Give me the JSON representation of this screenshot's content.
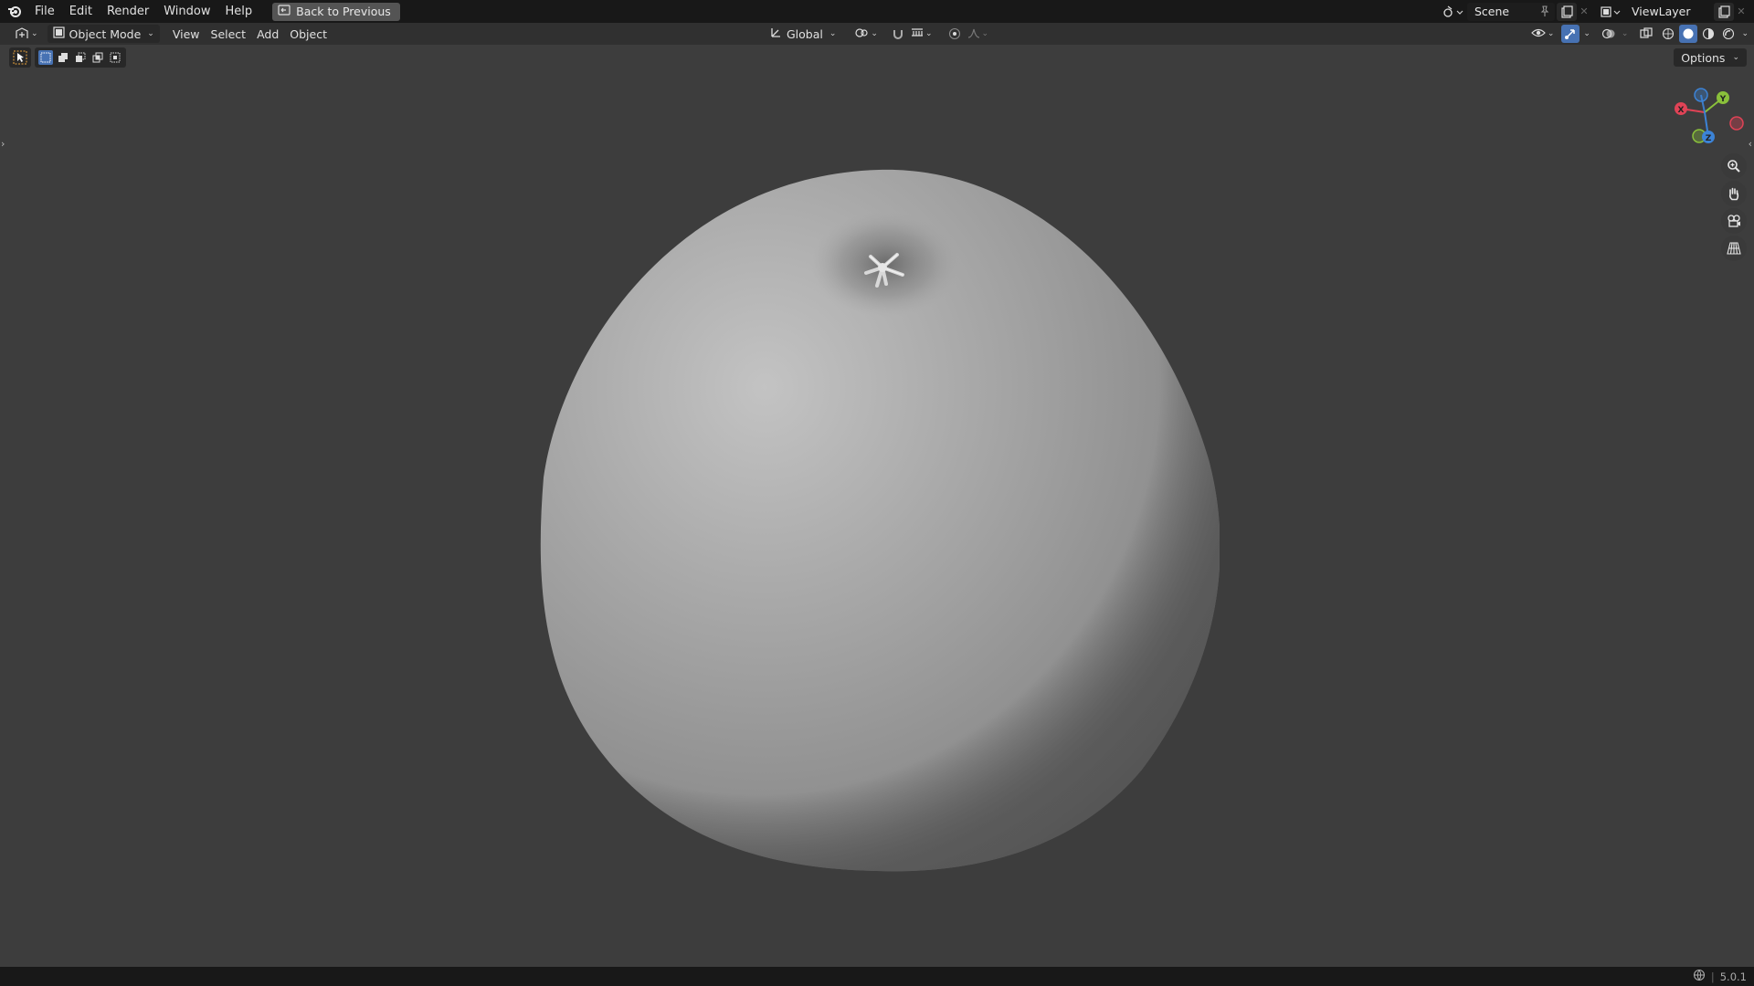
{
  "topbar": {
    "menu": [
      "File",
      "Edit",
      "Render",
      "Window",
      "Help"
    ],
    "back_button": "Back to Previous",
    "scene_name": "Scene",
    "view_layer_name": "ViewLayer"
  },
  "header": {
    "mode": "Object Mode",
    "menus": [
      "View",
      "Select",
      "Add",
      "Object"
    ],
    "transform_orientation": "Global"
  },
  "toolbar": {
    "options_label": "Options"
  },
  "gizmo": {
    "x_label": "X",
    "y_label": "Y",
    "z_label": "Z",
    "colors": {
      "x": "#e04356",
      "y": "#8ac03b",
      "z": "#3c83d6"
    }
  },
  "statusbar": {
    "version": "5.0.1"
  },
  "colors": {
    "viewport_bg": "#3d3d3d",
    "topbar_bg": "#181818",
    "header_bg": "#303030",
    "accent": "#4772b3"
  }
}
